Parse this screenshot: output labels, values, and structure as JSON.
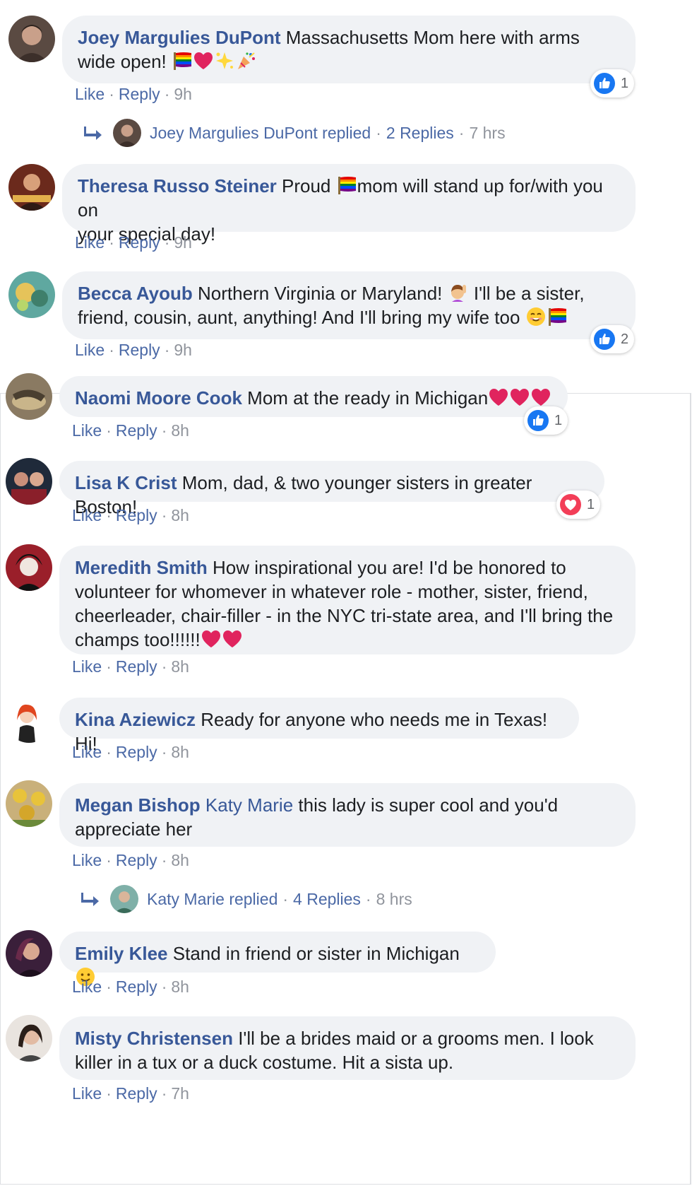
{
  "actions": {
    "like": "Like",
    "reply": "Reply",
    "dot": "·"
  },
  "colors": {
    "link": "#385898",
    "bubble": "#f0f2f5",
    "like_blue": "#1877f2",
    "love_red": "#f33e58"
  },
  "comments": [
    {
      "author": "Joey Margulies DuPont",
      "text": "Massachusetts Mom here with arms wide open!",
      "emoji": [
        "rainbow-flag",
        "red-heart",
        "dizzy-stars",
        "party-popper"
      ],
      "time": "9h",
      "reaction": {
        "type": "like",
        "count": "1"
      },
      "replies": {
        "name": "Joey Margulies DuPont replied",
        "count": "2 Replies",
        "time": "7 hrs"
      }
    },
    {
      "author": "Theresa Russo Steiner",
      "text_a": "Proud",
      "text_b": "mom will stand up for/with you on",
      "text_c": "your special day!",
      "time": "9h"
    },
    {
      "author": "Becca Ayoub",
      "text_a": "Northern Virginia or Maryland!",
      "text_b": "I'll be a sister,",
      "text_c": "friend, cousin, aunt, anything! And I'll bring my wife too",
      "time": "9h",
      "reaction": {
        "type": "like",
        "count": "2"
      }
    },
    {
      "author": "Naomi Moore Cook",
      "text": "Mom at the ready in Michigan",
      "time": "8h",
      "reaction": {
        "type": "like",
        "count": "1"
      }
    },
    {
      "author": "Lisa K Crist",
      "text": "Mom, dad, & two younger sisters in greater Boston!",
      "time": "8h",
      "reaction": {
        "type": "love",
        "count": "1"
      }
    },
    {
      "author": "Meredith Smith",
      "line1": "How inspirational you are! I'd be honored to",
      "line2": "volunteer for whomever in whatever role - mother, sister, friend,",
      "line3": "cheerleader, chair-filler - in the NYC tri-state area, and I'll bring the",
      "line4": "champs too!!!!!!",
      "time": "8h"
    },
    {
      "author": "Kina Aziewicz",
      "text": "Ready for anyone who needs me in Texas! Hi!",
      "time": "8h"
    },
    {
      "author": "Megan Bishop",
      "mention": "Katy Marie",
      "text_a": "this lady is super cool and you'd",
      "text_b": "appreciate her",
      "time": "8h",
      "replies": {
        "name": "Katy Marie replied",
        "count": "4 Replies",
        "time": "8 hrs"
      }
    },
    {
      "author": "Emily Klee",
      "text": "Stand in friend or sister in Michigan",
      "time": "8h"
    },
    {
      "author": "Misty Christensen",
      "text_a": "I'll be a brides maid or a grooms men. I look",
      "text_b": "killer in a tux or a duck costume. Hit a sista up.",
      "time": "7h"
    }
  ]
}
